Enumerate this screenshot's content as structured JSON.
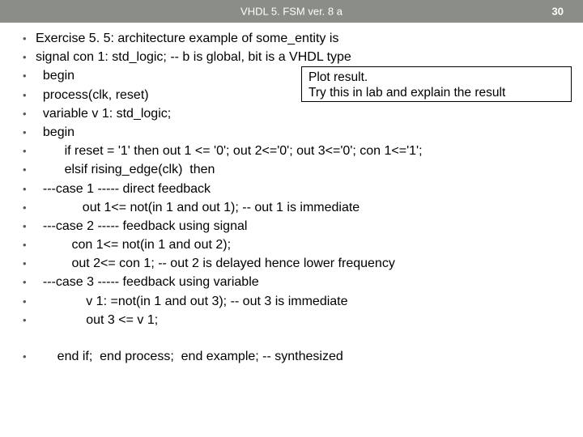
{
  "header": {
    "title": "VHDL 5. FSM ver. 8 a",
    "page": "30"
  },
  "callout": {
    "line1": "Plot result.",
    "line2": "Try this in lab and explain the result"
  },
  "lines": [
    "Exercise 5. 5: architecture example of some_entity is",
    "signal con 1: std_logic; -- b is global, bit is a VHDL type",
    "  begin",
    "  process(clk, reset)",
    "  variable v 1: std_logic;",
    "  begin",
    "        if reset = '1' then out 1 <= '0'; out 2<='0'; out 3<='0'; con 1<='1';",
    "        elsif rising_edge(clk)  then",
    "  ---case 1 ----- direct feedback",
    "             out 1<= not(in 1 and out 1); -- out 1 is immediate",
    "  ---case 2 ----- feedback using signal",
    "          con 1<= not(in 1 and out 2);",
    "          out 2<= con 1; -- out 2 is delayed hence lower frequency",
    "  ---case 3 ----- feedback using variable",
    "              v 1: =not(in 1 and out 3); -- out 3 is immediate",
    "              out 3 <= v 1;"
  ],
  "last_line": "      end if;  end process;  end example; -- synthesized"
}
